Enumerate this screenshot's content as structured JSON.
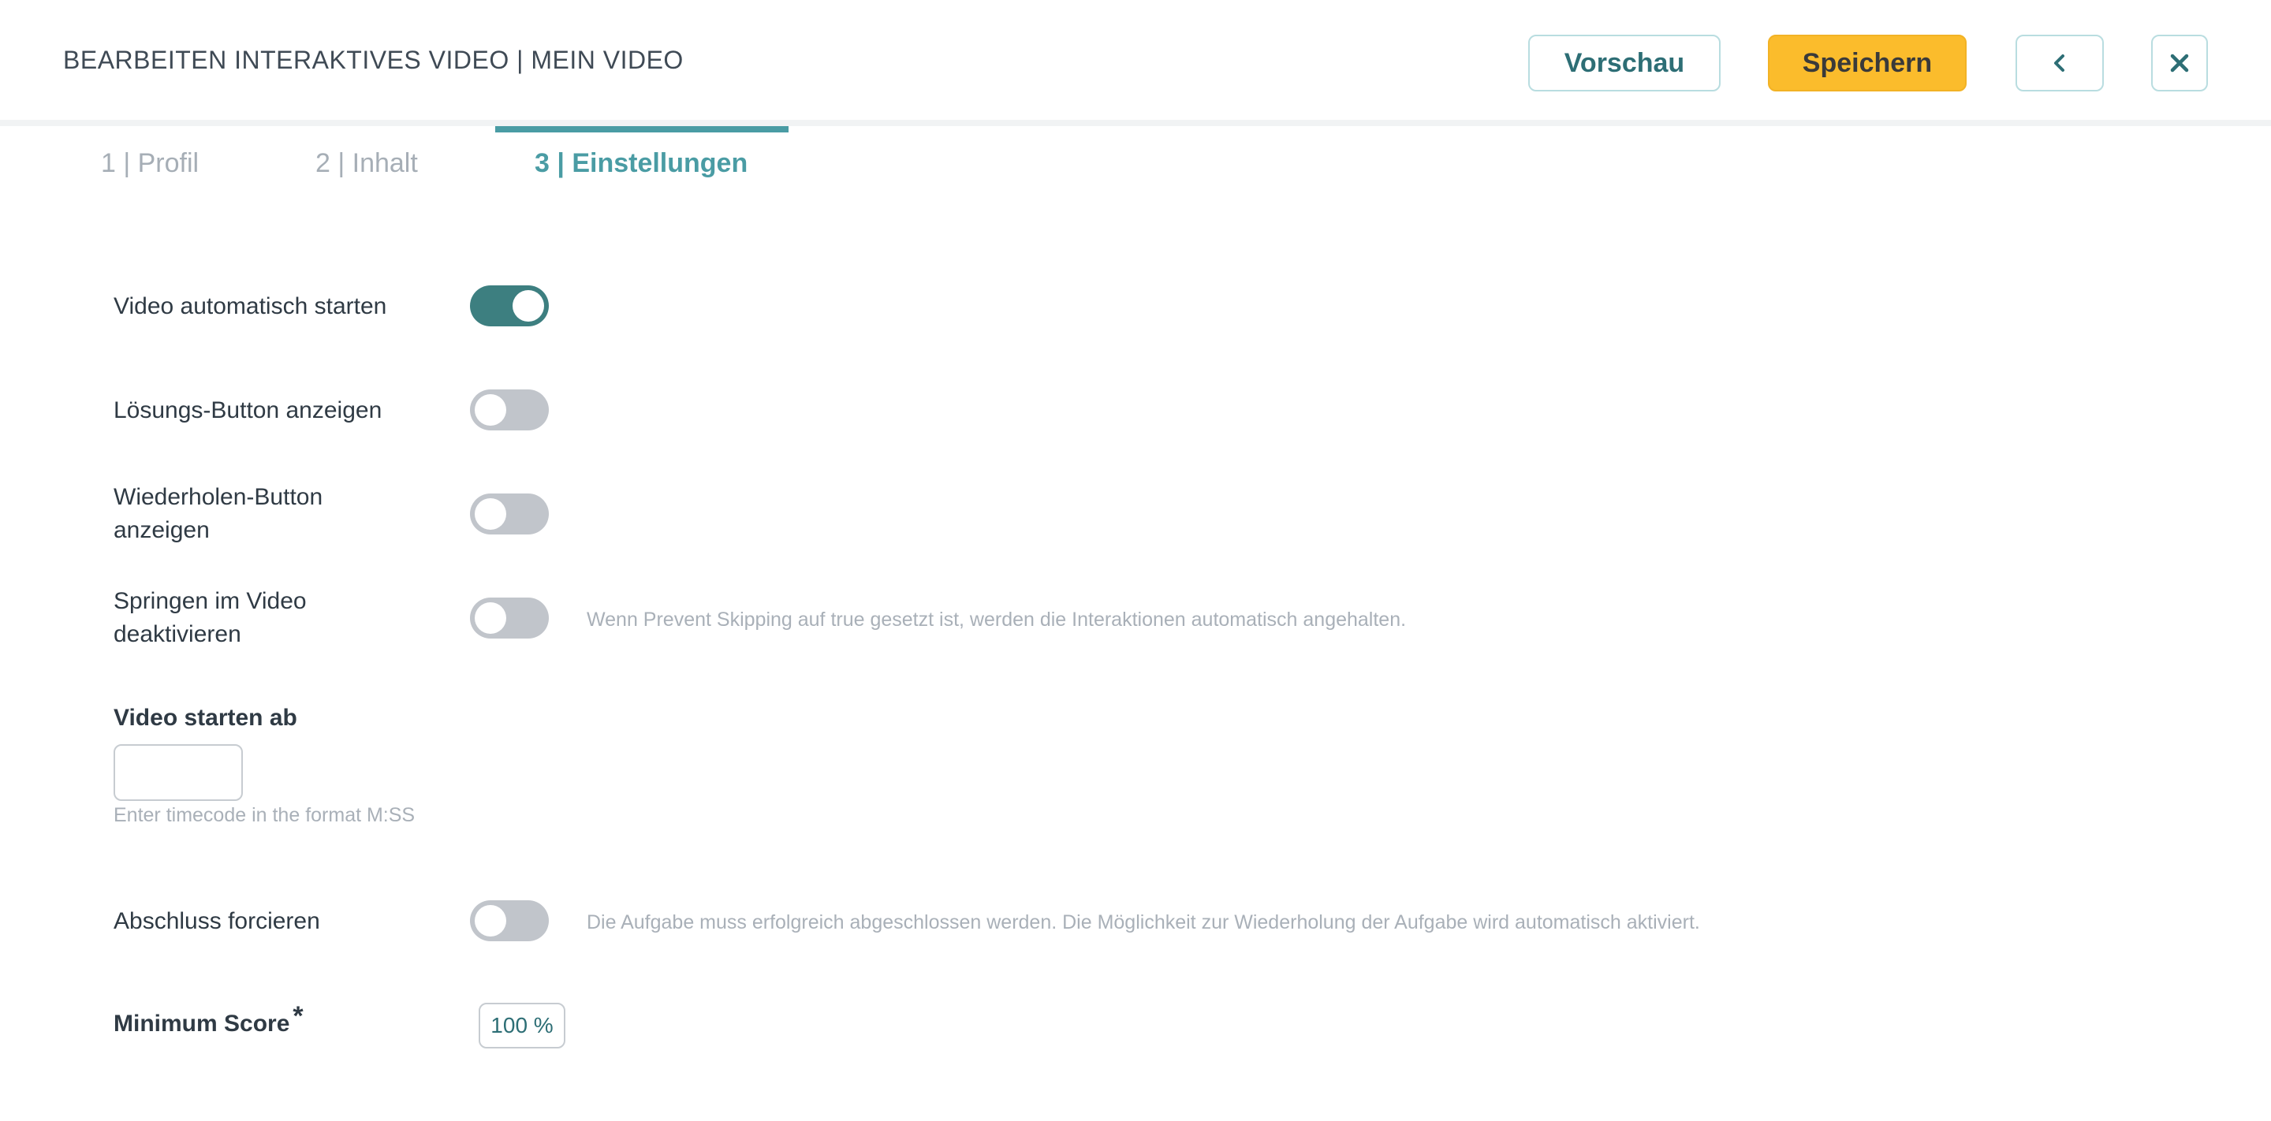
{
  "header": {
    "title": "BEARBEITEN INTERAKTIVES VIDEO | MEIN VIDEO",
    "preview_label": "Vorschau",
    "save_label": "Speichern",
    "back_icon": "chevron-left-icon",
    "close_icon": "close-icon"
  },
  "tabs": [
    {
      "label": "1 | Profil",
      "active": false
    },
    {
      "label": "2 | Inhalt",
      "active": false
    },
    {
      "label": "3 | Einstellungen",
      "active": true
    }
  ],
  "settings": {
    "autoplay": {
      "label": "Video automatisch starten",
      "on": true
    },
    "solution_button": {
      "label": "Lösungs-Button anzeigen",
      "on": false
    },
    "retry_button": {
      "label_line1": "Wiederholen-Button",
      "label_line2": "anzeigen",
      "on": false
    },
    "prevent_skipping": {
      "label_line1": "Springen im Video",
      "label_line2": "deaktivieren",
      "on": false,
      "hint": "Wenn Prevent Skipping auf true gesetzt ist, werden die Interaktionen automatisch angehalten."
    },
    "start_at": {
      "label": "Video starten ab",
      "value": "",
      "help": "Enter timecode in the format M:SS"
    },
    "force_completion": {
      "label": "Abschluss forcieren",
      "on": false,
      "hint": "Die Aufgabe muss erfolgreich abgeschlossen werden. Die Möglichkeit zur Wiederholung der Aufgabe wird automatisch aktiviert."
    },
    "minimum_score": {
      "label": "Minimum Score",
      "required_mark": "*",
      "value": "100 %"
    }
  },
  "colors": {
    "accent": "#4a9ca4",
    "toggle_on": "#3d7f80",
    "toggle_off": "#c1c5cb",
    "primary_button": "#fbbc2c"
  }
}
